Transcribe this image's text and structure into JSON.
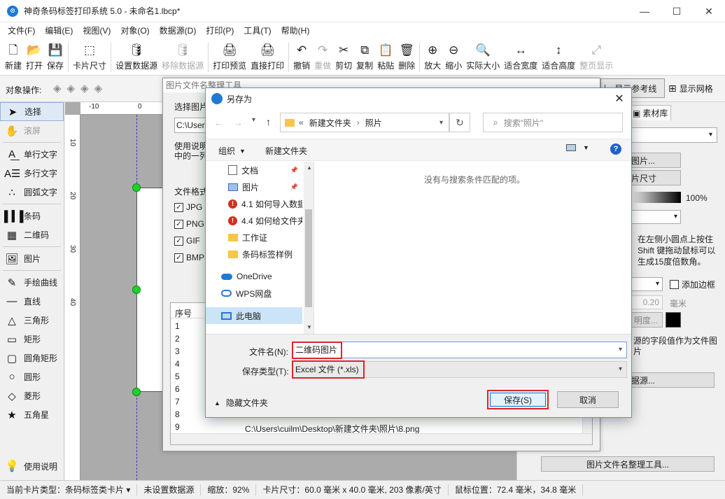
{
  "window": {
    "title": "神奇条码标签打印系统 5.0 - 未命名1.lbcp*",
    "minimize": "—",
    "maximize": "☐",
    "close": "✕"
  },
  "menu": [
    "文件(F)",
    "编辑(E)",
    "视图(V)",
    "对象(O)",
    "数据源(D)",
    "打印(P)",
    "工具(T)",
    "帮助(H)"
  ],
  "toolbar": [
    {
      "label": "新建",
      "icon": "new-file-icon",
      "glyph": "🗋",
      "disabled": false
    },
    {
      "label": "打开",
      "icon": "open-icon",
      "glyph": "📂",
      "disabled": false
    },
    {
      "label": "保存",
      "icon": "save-icon",
      "glyph": "💾",
      "disabled": false
    },
    {
      "sep": true
    },
    {
      "label": "卡片尺寸",
      "icon": "card-size-icon",
      "glyph": "⬚",
      "disabled": false
    },
    {
      "sep": true
    },
    {
      "label": "设置数据源",
      "icon": "database-icon",
      "glyph": "🛢",
      "disabled": false
    },
    {
      "label": "移除数据源",
      "icon": "remove-database-icon",
      "glyph": "🛢",
      "disabled": true
    },
    {
      "sep": true
    },
    {
      "label": "打印预览",
      "icon": "print-preview-icon",
      "glyph": "🖨",
      "disabled": false
    },
    {
      "label": "直接打印",
      "icon": "print-icon",
      "glyph": "🖨",
      "disabled": false
    },
    {
      "sep": true
    },
    {
      "label": "撤销",
      "icon": "undo-icon",
      "glyph": "↶",
      "disabled": false
    },
    {
      "label": "重做",
      "icon": "redo-icon",
      "glyph": "↷",
      "disabled": true
    },
    {
      "label": "剪切",
      "icon": "cut-icon",
      "glyph": "✂",
      "disabled": false
    },
    {
      "label": "复制",
      "icon": "copy-icon",
      "glyph": "⧉",
      "disabled": false
    },
    {
      "label": "粘贴",
      "icon": "paste-icon",
      "glyph": "📋",
      "disabled": false
    },
    {
      "label": "删除",
      "icon": "delete-icon",
      "glyph": "🗑",
      "disabled": false
    },
    {
      "sep": true
    },
    {
      "label": "放大",
      "icon": "zoom-in-icon",
      "glyph": "⊕",
      "disabled": false
    },
    {
      "label": "缩小",
      "icon": "zoom-out-icon",
      "glyph": "⊖",
      "disabled": false
    },
    {
      "label": "实际大小",
      "icon": "actual-size-icon",
      "glyph": "🔍",
      "disabled": false
    },
    {
      "label": "适合宽度",
      "icon": "fit-width-icon",
      "glyph": "↔",
      "disabled": false
    },
    {
      "label": "适合高度",
      "icon": "fit-height-icon",
      "glyph": "↕",
      "disabled": false
    },
    {
      "label": "整页显示",
      "icon": "full-page-icon",
      "glyph": "⤢",
      "disabled": true
    }
  ],
  "objbar": {
    "label": "对象操作:",
    "ref_line": "显示参考线",
    "show_grid": "显示网格"
  },
  "tools": [
    {
      "label": "选择",
      "glyph": "➤",
      "icon": "pointer-icon",
      "selected": true,
      "disabled": false
    },
    {
      "label": "滚屏",
      "glyph": "✋",
      "icon": "hand-icon",
      "selected": false,
      "disabled": true
    },
    {
      "sep": true
    },
    {
      "label": "单行文字",
      "glyph": "A͟",
      "icon": "single-line-text-icon",
      "selected": false,
      "disabled": false
    },
    {
      "label": "多行文字",
      "glyph": "A☰",
      "icon": "multi-line-text-icon",
      "selected": false,
      "disabled": false
    },
    {
      "label": "圆弧文字",
      "glyph": "∴",
      "icon": "arc-text-icon",
      "selected": false,
      "disabled": false
    },
    {
      "sep": true
    },
    {
      "label": "条码",
      "glyph": "▌▍▌",
      "icon": "barcode-icon",
      "selected": false,
      "disabled": false
    },
    {
      "label": "二维码",
      "glyph": "▦",
      "icon": "qrcode-icon",
      "selected": false,
      "disabled": false
    },
    {
      "sep": true
    },
    {
      "label": "图片",
      "glyph": "🖼",
      "icon": "picture-icon",
      "selected": false,
      "disabled": false
    },
    {
      "sep": true
    },
    {
      "label": "手绘曲线",
      "glyph": "✎",
      "icon": "freehand-icon",
      "selected": false,
      "disabled": false
    },
    {
      "label": "直线",
      "glyph": "—",
      "icon": "line-icon",
      "selected": false,
      "disabled": false
    },
    {
      "label": "三角形",
      "glyph": "△",
      "icon": "triangle-icon",
      "selected": false,
      "disabled": false
    },
    {
      "label": "矩形",
      "glyph": "▭",
      "icon": "rectangle-icon",
      "selected": false,
      "disabled": false
    },
    {
      "label": "圆角矩形",
      "glyph": "▢",
      "icon": "rounded-rect-icon",
      "selected": false,
      "disabled": false
    },
    {
      "label": "圆形",
      "glyph": "○",
      "icon": "circle-icon",
      "selected": false,
      "disabled": false
    },
    {
      "label": "菱形",
      "glyph": "◇",
      "icon": "diamond-icon",
      "selected": false,
      "disabled": false
    },
    {
      "label": "五角星",
      "glyph": "★",
      "icon": "star-icon",
      "selected": false,
      "disabled": false
    }
  ],
  "help_label": "使用说明",
  "ruler": {
    "h": [
      "-10",
      "0"
    ],
    "v": [
      "10",
      "20",
      "30",
      "40"
    ]
  },
  "right_panel": {
    "tab": "素材库",
    "btn_picture": "图片...",
    "btn_size": "片尺寸",
    "percent": "100%",
    "hint": "在左侧小圆点上按住 Shift 键拖动鼠标可以生成15度倍数角。",
    "add_border": "添加边框",
    "border_value": "0.20",
    "unit": "毫米",
    "opacity_btn": "明度...",
    "datasrc_text": "源的字段值作为文件图片",
    "datasrc_btn": "据源...",
    "organizer_btn": "图片文件名整理工具..."
  },
  "bg_dialog": {
    "title": "图片文件名整理工具",
    "choose_label": "选择图片",
    "path_value": "C:\\Users",
    "usage": "使用说明",
    "usage2": "中的一列",
    "format_label": "文件格式",
    "formats": [
      "JPG",
      "PNG",
      "GIF",
      "BMP"
    ],
    "col_seq": "序号",
    "rows": [
      "1",
      "2",
      "3",
      "4",
      "5",
      "6",
      "7",
      "8",
      "9"
    ],
    "last_row_path": "C:\\Users\\cuilm\\Desktop\\新建文件夹\\照片\\8.png"
  },
  "dialog": {
    "title": "另存为",
    "close": "✕",
    "path_sep": "«",
    "path": [
      "新建文件夹",
      "照片"
    ],
    "search_placeholder": "搜索\"照片\"",
    "organize": "组织",
    "new_folder": "新建文件夹",
    "help": "?",
    "empty_text": "没有与搜索条件匹配的项。",
    "nav": [
      {
        "label": "文档",
        "icon": "documents-icon",
        "pinned": true
      },
      {
        "label": "图片",
        "icon": "pictures-icon",
        "pinned": true
      },
      {
        "label": "4.1 如何导入数据",
        "icon": "doc-warning-icon",
        "pinned": false
      },
      {
        "label": "4.4 如何给文件夹",
        "icon": "doc-warning-icon",
        "pinned": false
      },
      {
        "label": "工作证",
        "icon": "folder-icon",
        "pinned": false
      },
      {
        "label": "条码标签样例",
        "icon": "folder-icon",
        "pinned": false
      },
      {
        "label": "OneDrive",
        "icon": "onedrive-icon",
        "pinned": false
      },
      {
        "label": "WPS网盘",
        "icon": "wps-cloud-icon",
        "pinned": false
      },
      {
        "label": "此电脑",
        "icon": "this-pc-icon",
        "pinned": false,
        "selected": true
      }
    ],
    "filename_label": "文件名(N):",
    "filename_value": "二维码图片",
    "filetype_label": "保存类型(T):",
    "filetype_value": "Excel 文件 (*.xls)",
    "hide_folders": "隐藏文件夹",
    "save": "保存(S)",
    "cancel": "取消"
  },
  "status": [
    "当前卡片类型：条码标签类卡片 ▾",
    "未设置数据源",
    "缩放：92%",
    "卡片尺寸：60.0 毫米 x 40.0 毫米, 203 像素/英寸",
    "鼠标位置：72.4 毫米，34.8 毫米"
  ],
  "colors": {
    "accent": "#1e7ad6",
    "highlight_red": "#e0242e",
    "folder": "#f5c648",
    "canvas": "#ababab",
    "handle": "#1fd12a"
  }
}
